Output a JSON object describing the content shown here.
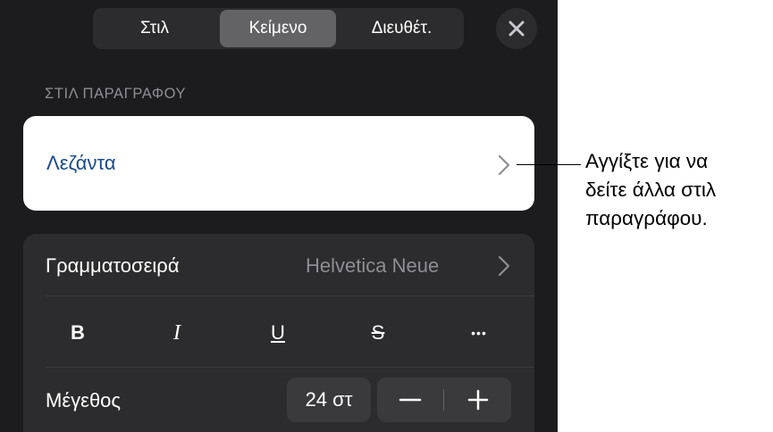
{
  "tabs": [
    {
      "label": "Στιλ",
      "active": false
    },
    {
      "label": "Κείμενο",
      "active": true
    },
    {
      "label": "Διευθέτ.",
      "active": false
    }
  ],
  "close_icon": "close-icon",
  "paragraph_style": {
    "header": "ΣΤΙΛ ΠΑΡΑΓΡΑΦΟΥ",
    "current": "Λεζάντα",
    "text_color": "#1a4a8a"
  },
  "font": {
    "label": "Γραμματοσειρά",
    "value": "Helvetica Neue"
  },
  "format_buttons": [
    {
      "name": "bold",
      "glyph": "B"
    },
    {
      "name": "italic",
      "glyph": "I"
    },
    {
      "name": "underline",
      "glyph": "U"
    },
    {
      "name": "strikethrough",
      "glyph": "S"
    },
    {
      "name": "more",
      "glyph": "•••"
    }
  ],
  "size": {
    "label": "Μέγεθος",
    "value": "24 στ",
    "decrease": "−",
    "increase": "+"
  },
  "callout": {
    "lines": [
      "Αγγίξτε για να",
      "δείτε άλλα στιλ",
      "παραγράφου."
    ]
  },
  "colors": {
    "panel_bg": "#1c1c1e",
    "group_bg": "#2c2c2e",
    "active_tab": "#636366",
    "secondary_text": "#8e8e93"
  }
}
